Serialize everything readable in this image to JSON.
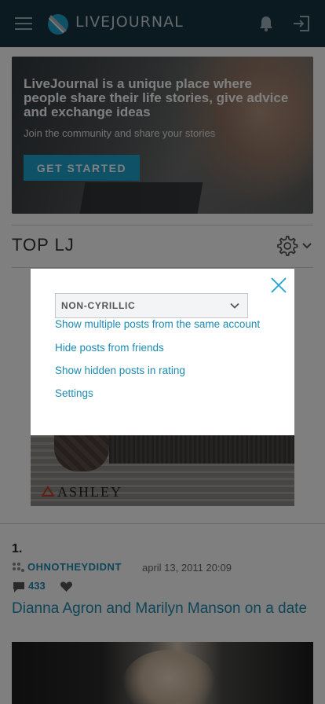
{
  "header": {
    "logo_text": "LIVEJOURNAL"
  },
  "hero": {
    "title": "LiveJournal is a unique place where people share their life stories, give advice and exchange ideas",
    "subtitle": "Join the community and share your stories",
    "button_label": "GET STARTED"
  },
  "section": {
    "title": "TOP LJ"
  },
  "ad": {
    "brand": "ASHLEY"
  },
  "post": {
    "rank": "1.",
    "author": "OHNOTHEYDIDNT",
    "date": "april 13, 2011 20:09",
    "comments": "433",
    "title": "Dianna Agron and Marilyn Manson on a date"
  },
  "modal": {
    "select_value": "NON-CYRILLIC",
    "links": [
      "Show multiple posts from the same account",
      "Hide posts from friends",
      "Show hidden posts in rating",
      "Settings"
    ]
  },
  "colors": {
    "header_bg": "#173442",
    "accent": "#1c8ab3",
    "button": "#1fa3cf"
  }
}
